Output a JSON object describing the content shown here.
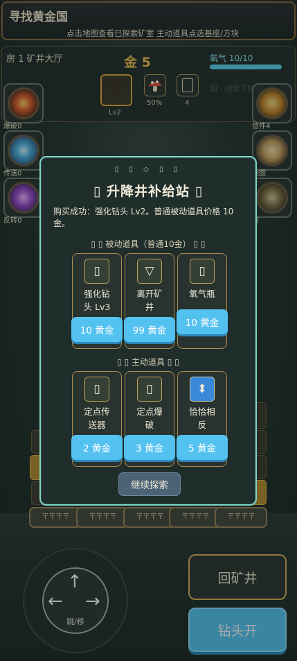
{
  "game": {
    "title": "寻找黄金国",
    "subtitle": "点击地图查看已探索矿室 主动道具点选基座/方块"
  },
  "hud": {
    "room": "房 1 矿井大厅",
    "gold": "金 5",
    "oxygen_label": "氧气 10/10",
    "oxygen_fraction": 1.0,
    "drill_level": "Lv2",
    "slot2_value": "50%",
    "slot3_value": "4",
    "bg_hint": "如 · 继续下轮"
  },
  "side_left": [
    {
      "label": "爆破0",
      "icon": "explosion-orb-icon"
    },
    {
      "label": "传送0",
      "icon": "swirl-portal-orb-icon"
    },
    {
      "label": "反转0",
      "icon": "crystal-orb-icon"
    }
  ],
  "side_right": [
    {
      "label": "信件4",
      "icon": "scroll-orb-icon"
    },
    {
      "label": "地图",
      "icon": "map-orb-icon"
    },
    {
      "label": "鉴",
      "icon": "book-orb-icon"
    }
  ],
  "floor_track": [
    "〒〒〒〒",
    "〒〒〒〒",
    "〒〒〒〒",
    "〒〒〒〒",
    "〒〒〒〒"
  ],
  "modal": {
    "decoration": "▯ ▯ ◇ ▯ ▯",
    "title": "▯  升降井补给站 ▯",
    "message": "购买成功：强化钻头 Lv2。普通被动道具价格 10 金。",
    "passive_header": "▯ ▯  被动道具（普通10金） ▯ ▯",
    "active_header": "▯ ▯  主动道具  ▯ ▯",
    "passive_items": [
      {
        "name_line1": "强化钻",
        "name_line2": "头 Lv3",
        "price": "10 黄金",
        "icon": "drill-upgrade-icon",
        "glyph": "▯"
      },
      {
        "name_line1": "离开矿",
        "name_line2": "井",
        "price": "99 黄金",
        "icon": "exit-down-triangle-icon",
        "glyph": "▽"
      },
      {
        "name_line1": "氧气瓶",
        "name_line2": "",
        "price": "10 黄金",
        "icon": "oxygen-tank-icon",
        "glyph": "▯"
      }
    ],
    "active_items": [
      {
        "name_line1": "定点传",
        "name_line2": "送器",
        "price": "2 黄金",
        "icon": "teleporter-icon",
        "glyph": "▯"
      },
      {
        "name_line1": "定点爆",
        "name_line2": "破",
        "price": "3 黄金",
        "icon": "bomb-icon",
        "glyph": "▯"
      },
      {
        "name_line1": "恰恰相",
        "name_line2": "反",
        "price": "5 黄金",
        "icon": "up-down-arrow-icon",
        "glyph": "⬍"
      }
    ],
    "continue_label": "继续探索"
  },
  "controls": {
    "joystick_label": "跳/移",
    "back_label": "回矿井",
    "drill_label": "钻头开"
  },
  "colors": {
    "accent_blue": "#54c2f1",
    "gold": "#f2c14e",
    "modal_border": "#7fd6c8",
    "frame_gold": "#d7b15b"
  }
}
